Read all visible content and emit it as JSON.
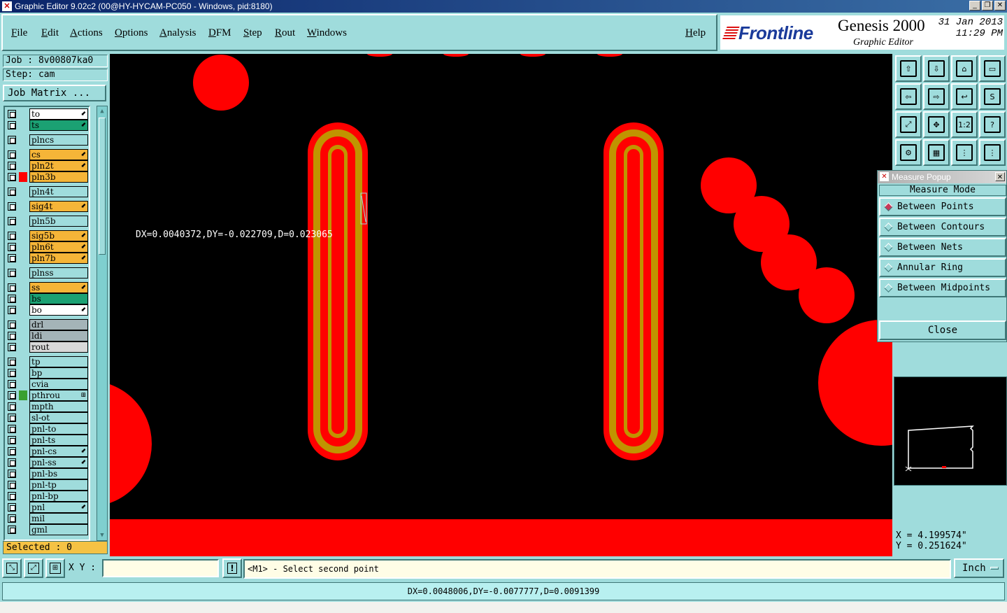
{
  "window": {
    "title": "Graphic Editor 9.02c2 (00@HY-HYCAM-PC050 - Windows, pid:8180)"
  },
  "menu": {
    "items": [
      "File",
      "Edit",
      "Actions",
      "Options",
      "Analysis",
      "DFM",
      "Step",
      "Rout",
      "Windows"
    ],
    "help": "Help"
  },
  "brand": {
    "logo": "Frontline",
    "product": "Genesis 2000",
    "subtitle": "Graphic Editor",
    "date": "31 Jan 2013",
    "time": "11:29 PM"
  },
  "job": {
    "job_line": "Job : 8v00807ka0",
    "step_line": "Step: cam",
    "matrix_button": "Job Matrix ..."
  },
  "layers": [
    {
      "name": "to",
      "color": "#ffffff",
      "ind": "⬋"
    },
    {
      "name": "ts",
      "color": "#1ba173",
      "ind": "⬋"
    },
    {
      "name": "plncs",
      "color": "#9fdcdc",
      "ind": ""
    },
    {
      "name": "cs",
      "color": "#f5b538",
      "ind": "⬋"
    },
    {
      "name": "pln2t",
      "color": "#f5b538",
      "ind": "⬋"
    },
    {
      "name": "pln3b",
      "color": "#f5b538",
      "ind": "",
      "swatch": "#ff0000"
    },
    {
      "name": "pln4t",
      "color": "#9fdcdc",
      "ind": ""
    },
    {
      "name": "sig4t",
      "color": "#f5b538",
      "ind": "⬋"
    },
    {
      "name": "pln5b",
      "color": "#9fdcdc",
      "ind": ""
    },
    {
      "name": "sig5b",
      "color": "#f5b538",
      "ind": "⬋"
    },
    {
      "name": "pln6t",
      "color": "#f5b538",
      "ind": "⬋"
    },
    {
      "name": "pln7b",
      "color": "#f5b538",
      "ind": "⬋"
    },
    {
      "name": "plnss",
      "color": "#9fdcdc",
      "ind": ""
    },
    {
      "name": "ss",
      "color": "#f5b538",
      "ind": "⬋"
    },
    {
      "name": "bs",
      "color": "#1ba173",
      "ind": ""
    },
    {
      "name": "bo",
      "color": "#ffffff",
      "ind": "⬋"
    },
    {
      "name": "drl",
      "color": "#a4b4b8",
      "ind": ""
    },
    {
      "name": "ldi",
      "color": "#a4b4b8",
      "ind": ""
    },
    {
      "name": "rout",
      "color": "#d8d8d8",
      "ind": ""
    },
    {
      "name": "tp",
      "color": "#9fdcdc",
      "ind": ""
    },
    {
      "name": "bp",
      "color": "#9fdcdc",
      "ind": ""
    },
    {
      "name": "cvia",
      "color": "#9fdcdc",
      "ind": ""
    },
    {
      "name": "pthrou",
      "color": "#9fdcdc",
      "ind": "⊞",
      "swatch": "#3aa030"
    },
    {
      "name": "mpth",
      "color": "#9fdcdc",
      "ind": ""
    },
    {
      "name": "sl-ot",
      "color": "#9fdcdc",
      "ind": ""
    },
    {
      "name": "pnl-to",
      "color": "#9fdcdc",
      "ind": ""
    },
    {
      "name": "pnl-ts",
      "color": "#9fdcdc",
      "ind": ""
    },
    {
      "name": "pnl-cs",
      "color": "#9fdcdc",
      "ind": "⬋"
    },
    {
      "name": "pnl-ss",
      "color": "#9fdcdc",
      "ind": "⬋"
    },
    {
      "name": "pnl-bs",
      "color": "#9fdcdc",
      "ind": ""
    },
    {
      "name": "pnl-tp",
      "color": "#9fdcdc",
      "ind": ""
    },
    {
      "name": "pnl-bp",
      "color": "#9fdcdc",
      "ind": ""
    },
    {
      "name": "pnl",
      "color": "#9fdcdc",
      "ind": "⬋"
    },
    {
      "name": "mil",
      "color": "#9fdcdc",
      "ind": ""
    },
    {
      "name": "gml",
      "color": "#9fdcdc",
      "ind": ""
    }
  ],
  "selected": "Selected : 0",
  "canvas": {
    "measure_label": "DX=0.0040372,DY=-0.022709,D=0.023065"
  },
  "tools": [
    "upload-icon",
    "download-icon",
    "home-icon",
    "panel-icon",
    "arrow-left-icon",
    "arrow-right-icon",
    "snap-icon",
    "route-icon",
    "zoom-fit-icon",
    "pan-icon",
    "zoom-1-2-icon",
    "help-icon",
    "tools-icon",
    "grid-icon",
    "layers-red-icon",
    "layers-red-2-icon"
  ],
  "tool_labels": [
    "⇧",
    "⇩",
    "⌂",
    "▭",
    "⇦",
    "⇨",
    "↩",
    "S",
    "⤢",
    "✥",
    "1:2",
    "?",
    "⚙",
    "▦",
    "⋮",
    "⋮"
  ],
  "measure": {
    "title": "Measure Popup",
    "mode_label": "Measure Mode",
    "options": [
      "Between Points",
      "Between Contours",
      "Between Nets",
      "Annular Ring",
      "Between Midpoints"
    ],
    "selected_index": 0,
    "close": "Close"
  },
  "coords": {
    "x": "X = 4.199574\"",
    "y": "Y = 0.251624\""
  },
  "bottom": {
    "xy_label": "X Y :",
    "xy_value": "",
    "warn": "!",
    "prompt": "<M1> - Select second point",
    "units": "Inch"
  },
  "status": "DX=0.0048006,DY=-0.0077777,D=0.0091399",
  "colors": {
    "pad": "#ff0000",
    "ring": "#c09400",
    "background": "#000000",
    "panel": "#9fdcdc"
  }
}
